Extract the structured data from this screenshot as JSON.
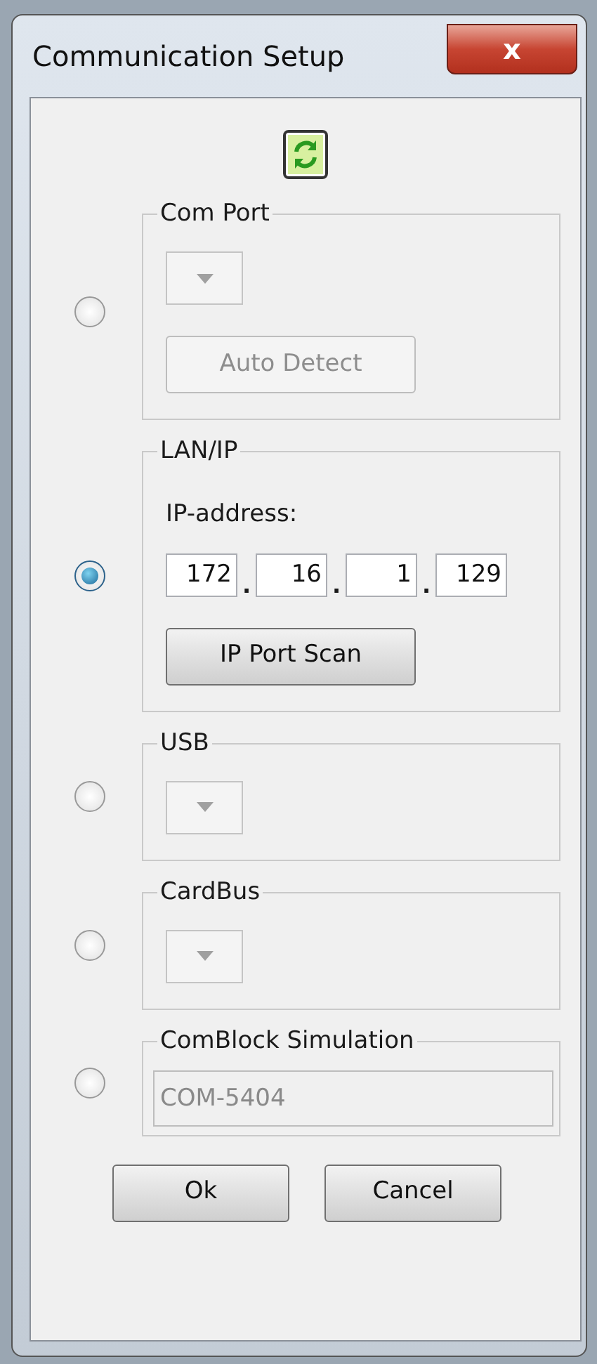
{
  "window": {
    "title": "Communication Setup",
    "close_label": "x"
  },
  "sections": [
    {
      "title": "Com Port",
      "selected": false,
      "kind": "dropdown",
      "button": {
        "label": "Auto Detect",
        "disabled": true
      }
    },
    {
      "title": "LAN/IP",
      "selected": true,
      "kind": "ip",
      "label": "IP-address:",
      "octets": [
        "172",
        "16",
        "1",
        "129"
      ],
      "separators": [
        ".",
        ".",
        "."
      ],
      "button": {
        "label": "IP Port Scan",
        "disabled": false
      }
    },
    {
      "title": "USB",
      "selected": false,
      "kind": "dropdown"
    },
    {
      "title": "CardBus",
      "selected": false,
      "kind": "dropdown"
    },
    {
      "title": "ComBlock Simulation",
      "selected": false,
      "kind": "text",
      "value": "COM-5404",
      "disabled": true
    }
  ],
  "buttons": [
    "Ok",
    "Cancel"
  ]
}
